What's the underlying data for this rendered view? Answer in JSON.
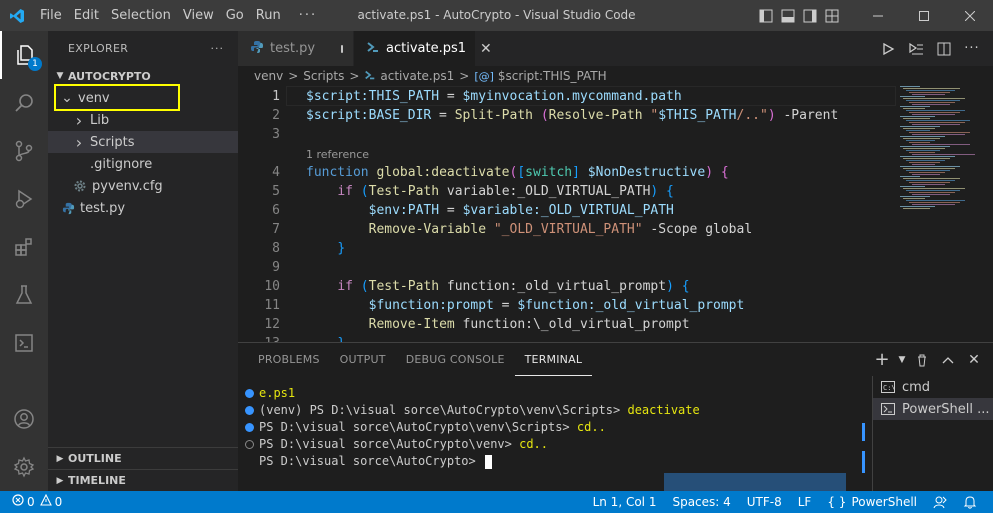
{
  "titlebar": {
    "menu": [
      "File",
      "Edit",
      "Selection",
      "View",
      "Go",
      "Run",
      "···"
    ],
    "window_title": "activate.ps1 - AutoCrypto - Visual Studio Code"
  },
  "activity": {
    "explorer_badge": "1",
    "items": [
      "explorer-icon",
      "search-icon",
      "source-control-icon",
      "run-debug-icon",
      "extensions-icon",
      "testing-icon",
      "remote-explorer-icon",
      "account-icon",
      "settings-gear-icon"
    ]
  },
  "sidebar": {
    "title": "EXPLORER",
    "more": "···",
    "folder": "AUTOCRYPTO",
    "tree": [
      {
        "label": "venv",
        "depth": 1,
        "kind": "folder-open"
      },
      {
        "label": "Lib",
        "depth": 2,
        "kind": "folder"
      },
      {
        "label": "Scripts",
        "depth": 2,
        "kind": "folder",
        "selected": true
      },
      {
        "label": ".gitignore",
        "depth": 2,
        "kind": "file"
      },
      {
        "label": "pyvenv.cfg",
        "depth": 2,
        "kind": "gear"
      },
      {
        "label": "test.py",
        "depth": 1,
        "kind": "python"
      }
    ],
    "outline": "OUTLINE",
    "timeline": "TIMELINE"
  },
  "tabs": [
    {
      "label": "test.py",
      "icon": "python-icon",
      "modified": true,
      "active": false
    },
    {
      "label": "activate.ps1",
      "icon": "powershell-icon",
      "active": true
    }
  ],
  "breadcrumb": [
    "venv",
    "Scripts",
    "activate.ps1",
    "$script:THIS_PATH"
  ],
  "code": {
    "codelens": "1 reference",
    "lines": [
      {
        "n": "1",
        "tokens": [
          [
            "$script:THIS_PATH",
            "var"
          ],
          [
            " = ",
            "op"
          ],
          [
            "$myinvocation.mycommand.path",
            "var"
          ]
        ]
      },
      {
        "n": "2",
        "tokens": [
          [
            "$script:BASE_DIR",
            "var"
          ],
          [
            " = ",
            "op"
          ],
          [
            "Split-Path",
            "fn"
          ],
          [
            " ",
            "op"
          ],
          [
            "(",
            "par"
          ],
          [
            "Resolve-Path",
            "fn"
          ],
          [
            " \"",
            "str"
          ],
          [
            "$THIS_PATH",
            "var"
          ],
          [
            "/..\"",
            "str"
          ],
          [
            ")",
            "par"
          ],
          [
            " -Parent",
            "op"
          ]
        ]
      },
      {
        "n": "3",
        "tokens": []
      },
      {
        "n": "4",
        "tokens": [
          [
            "function",
            "kw"
          ],
          [
            " global:deactivate",
            "fn"
          ],
          [
            "(",
            "par"
          ],
          [
            "[",
            "brk"
          ],
          [
            "switch",
            "typ"
          ],
          [
            "]",
            "brk"
          ],
          [
            " $NonDestructive",
            "var"
          ],
          [
            ")",
            "par"
          ],
          [
            " {",
            "par"
          ]
        ]
      },
      {
        "n": "5",
        "tokens": [
          [
            "    ",
            "op"
          ],
          [
            "if",
            "ctl"
          ],
          [
            " ",
            "op"
          ],
          [
            "(",
            "brk"
          ],
          [
            "Test-Path",
            "fn"
          ],
          [
            " variable:_OLD_VIRTUAL_PATH",
            "op"
          ],
          [
            ")",
            "brk"
          ],
          [
            " {",
            "brk"
          ]
        ]
      },
      {
        "n": "6",
        "tokens": [
          [
            "        ",
            "op"
          ],
          [
            "$env:PATH",
            "var"
          ],
          [
            " = ",
            "op"
          ],
          [
            "$variable:_OLD_VIRTUAL_PATH",
            "var"
          ]
        ]
      },
      {
        "n": "7",
        "tokens": [
          [
            "        ",
            "op"
          ],
          [
            "Remove-Variable",
            "fn"
          ],
          [
            " \"_OLD_VIRTUAL_PATH\"",
            "str"
          ],
          [
            " -Scope global",
            "op"
          ]
        ]
      },
      {
        "n": "8",
        "tokens": [
          [
            "    ",
            "op"
          ],
          [
            "}",
            "brk"
          ]
        ]
      },
      {
        "n": "9",
        "tokens": []
      },
      {
        "n": "10",
        "tokens": [
          [
            "    ",
            "op"
          ],
          [
            "if",
            "ctl"
          ],
          [
            " ",
            "op"
          ],
          [
            "(",
            "brk"
          ],
          [
            "Test-Path",
            "fn"
          ],
          [
            " function:_old_virtual_prompt",
            "op"
          ],
          [
            ")",
            "brk"
          ],
          [
            " {",
            "brk"
          ]
        ]
      },
      {
        "n": "11",
        "tokens": [
          [
            "        ",
            "op"
          ],
          [
            "$function:prompt",
            "var"
          ],
          [
            " = ",
            "op"
          ],
          [
            "$function:_old_virtual_prompt",
            "var"
          ]
        ]
      },
      {
        "n": "12",
        "tokens": [
          [
            "        ",
            "op"
          ],
          [
            "Remove-Item",
            "fn"
          ],
          [
            " function:\\_old_virtual_prompt",
            "op"
          ]
        ]
      },
      {
        "n": "13",
        "tokens": [
          [
            "    ",
            "op"
          ],
          [
            "}",
            "brk"
          ]
        ]
      }
    ]
  },
  "panel": {
    "tabs": [
      "PROBLEMS",
      "OUTPUT",
      "DEBUG CONSOLE",
      "TERMINAL"
    ],
    "active_tab": "TERMINAL",
    "terminal_lines": [
      {
        "marker": "blue",
        "parts": [
          [
            "e.ps1",
            "y"
          ]
        ]
      },
      {
        "marker": "blue",
        "parts": [
          [
            "(venv) PS D:\\visual sorce\\AutoCrypto\\venv\\Scripts> ",
            "w"
          ],
          [
            "deactivate",
            "y"
          ]
        ]
      },
      {
        "marker": "blue",
        "parts": [
          [
            "PS D:\\visual sorce\\AutoCrypto\\venv\\Scripts> ",
            "w"
          ],
          [
            "cd..",
            "y"
          ]
        ]
      },
      {
        "marker": "hollow",
        "parts": [
          [
            "PS D:\\visual sorce\\AutoCrypto\\venv> ",
            "w"
          ],
          [
            "cd..",
            "y"
          ]
        ]
      },
      {
        "marker": "none",
        "parts": [
          [
            "PS D:\\visual sorce\\AutoCrypto> ",
            "w"
          ]
        ]
      }
    ],
    "terminals": [
      "cmd",
      "PowerShell ..."
    ]
  },
  "statusbar": {
    "errors": "0",
    "warnings": "0",
    "position": "Ln 1, Col 1",
    "spaces": "Spaces: 4",
    "encoding": "UTF-8",
    "eol": "LF",
    "language": "PowerShell",
    "lang_icon": "{ }"
  },
  "colors": {
    "accent": "#007acc",
    "highlight_box": "#ffff00"
  }
}
